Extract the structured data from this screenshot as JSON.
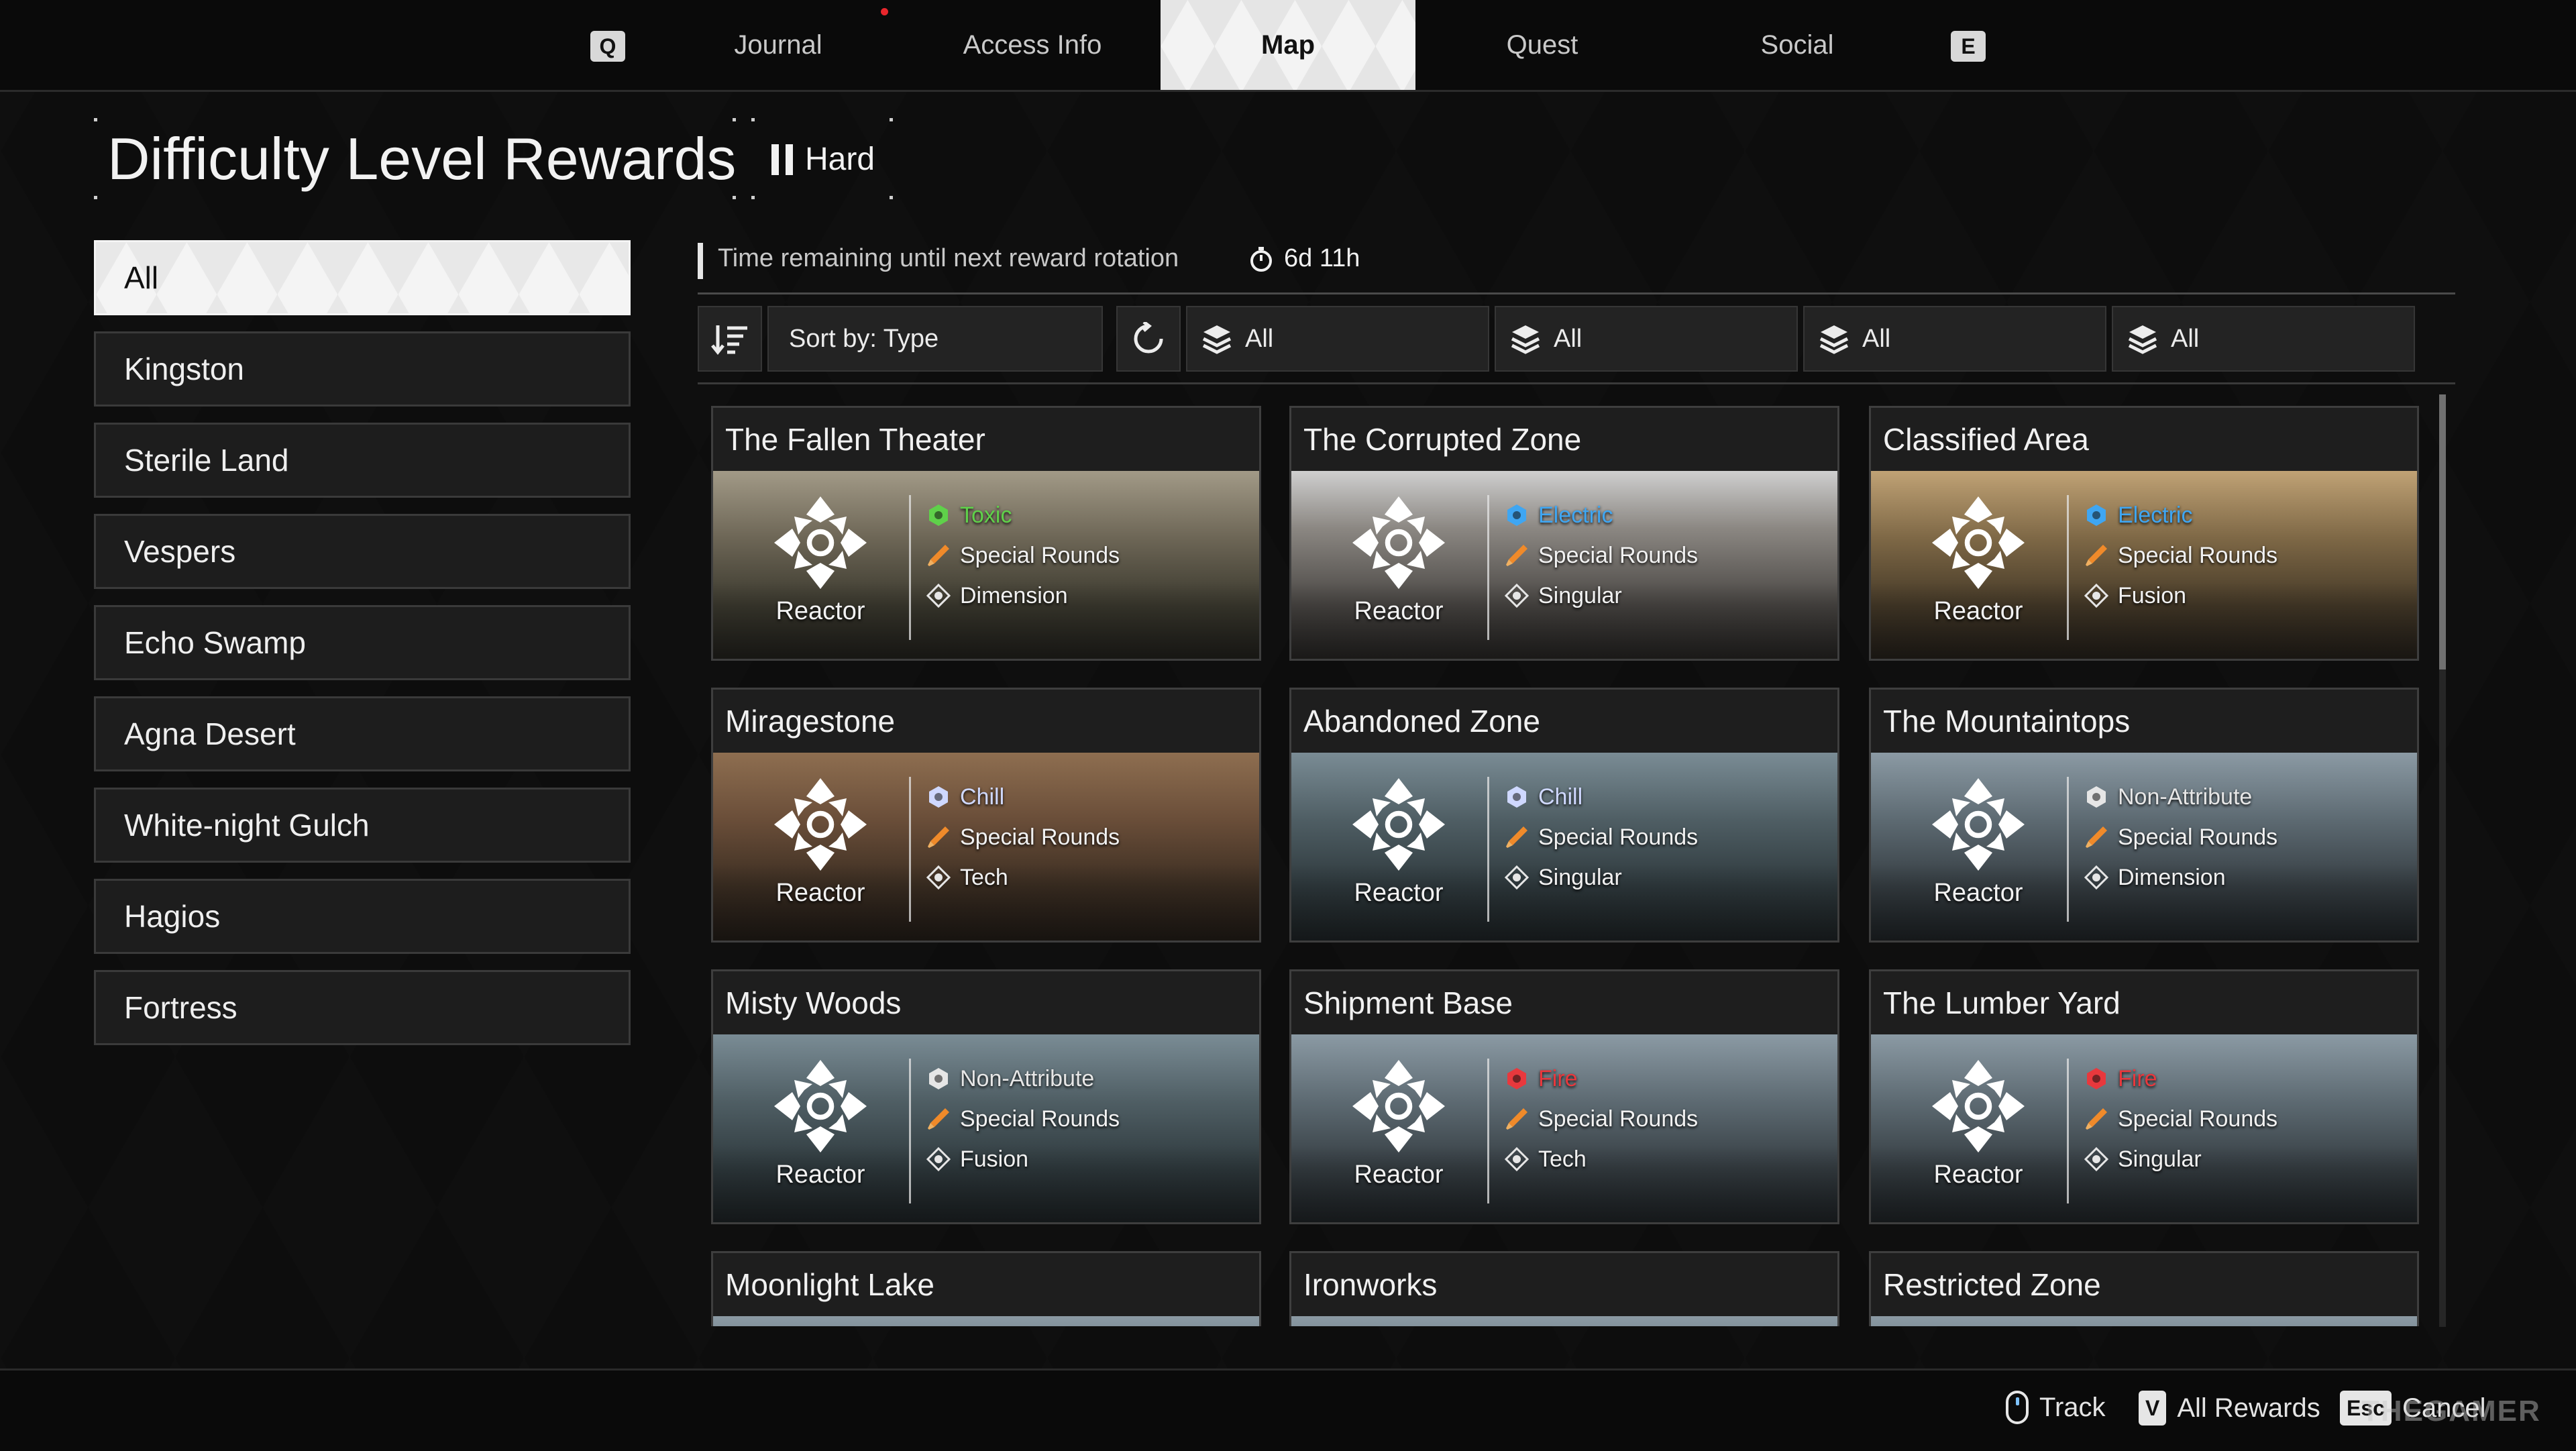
{
  "topnav": {
    "left_key": "Q",
    "right_key": "E",
    "tabs": [
      {
        "label": "Journal"
      },
      {
        "label": "Access Info"
      },
      {
        "label": "Map"
      },
      {
        "label": "Quest"
      },
      {
        "label": "Social"
      }
    ],
    "active_tab": "Map"
  },
  "header": {
    "title": "Difficulty Level Rewards",
    "difficulty": "Hard"
  },
  "sidebar": {
    "items": [
      {
        "label": "All",
        "active": true
      },
      {
        "label": "Kingston"
      },
      {
        "label": "Sterile Land"
      },
      {
        "label": "Vespers"
      },
      {
        "label": "Echo Swamp"
      },
      {
        "label": "Agna Desert"
      },
      {
        "label": "White-night Gulch"
      },
      {
        "label": "Hagios"
      },
      {
        "label": "Fortress"
      }
    ]
  },
  "rotation": {
    "label": "Time remaining until next reward rotation",
    "value": "6d 11h"
  },
  "filters": {
    "sort_label": "Sort by: Type",
    "filter1": "All",
    "filter2": "All",
    "filter3": "All",
    "filter4": "All"
  },
  "cards": [
    {
      "title": "The Fallen Theater",
      "reward": "Reactor",
      "attribute": "Toxic",
      "ammo": "Special Rounds",
      "skill": "Dimension"
    },
    {
      "title": "The Corrupted Zone",
      "reward": "Reactor",
      "attribute": "Electric",
      "ammo": "Special Rounds",
      "skill": "Singular"
    },
    {
      "title": "Classified Area",
      "reward": "Reactor",
      "attribute": "Electric",
      "ammo": "Special Rounds",
      "skill": "Fusion"
    },
    {
      "title": "Miragestone",
      "reward": "Reactor",
      "attribute": "Chill",
      "ammo": "Special Rounds",
      "skill": "Tech"
    },
    {
      "title": "Abandoned Zone",
      "reward": "Reactor",
      "attribute": "Chill",
      "ammo": "Special Rounds",
      "skill": "Singular"
    },
    {
      "title": "The Mountaintops",
      "reward": "Reactor",
      "attribute": "Non-Attribute",
      "ammo": "Special Rounds",
      "skill": "Dimension"
    },
    {
      "title": "Misty Woods",
      "reward": "Reactor",
      "attribute": "Non-Attribute",
      "ammo": "Special Rounds",
      "skill": "Fusion"
    },
    {
      "title": "Shipment Base",
      "reward": "Reactor",
      "attribute": "Fire",
      "ammo": "Special Rounds",
      "skill": "Tech"
    },
    {
      "title": "The Lumber Yard",
      "reward": "Reactor",
      "attribute": "Fire",
      "ammo": "Special Rounds",
      "skill": "Singular"
    },
    {
      "title": "Moonlight Lake"
    },
    {
      "title": "Ironworks"
    },
    {
      "title": "Restricted Zone"
    }
  ],
  "attribute_colors": {
    "Toxic": "#5fd14a",
    "Electric": "#3fa6f2",
    "Chill": "#cfd8ff",
    "Non-Attribute": "#e6e6e6",
    "Fire": "#e8383d"
  },
  "footer": {
    "track_label": "Track",
    "all_rewards_key": "V",
    "all_rewards_label": "All Rewards",
    "cancel_key": "Esc",
    "cancel_label": "Cancel",
    "watermark": "THEGAMER"
  }
}
